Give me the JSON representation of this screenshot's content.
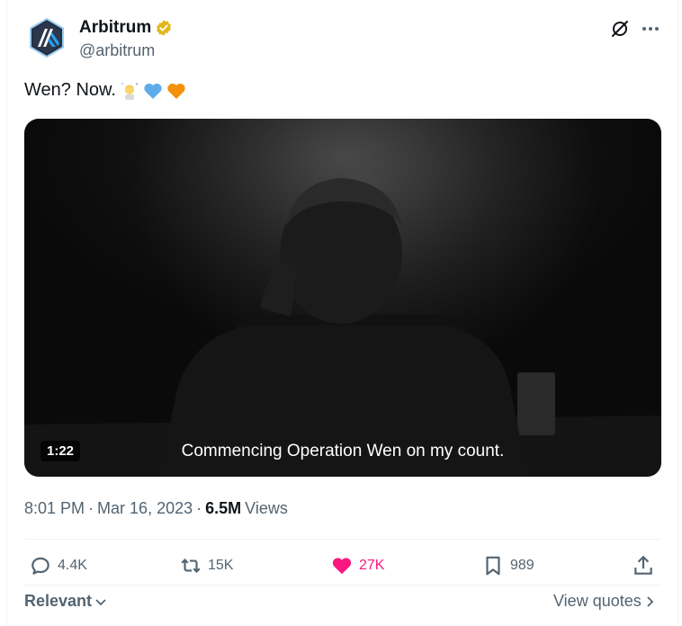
{
  "author": {
    "display_name": "Arbitrum",
    "handle": "@arbitrum",
    "verified_color": "#e2b719"
  },
  "tweet": {
    "text": "Wen? Now.",
    "emojis": [
      "mage-emoji",
      "blue-heart-emoji",
      "orange-heart-emoji"
    ]
  },
  "media": {
    "duration": "1:22",
    "caption": "Commencing Operation Wen on my count."
  },
  "meta": {
    "time": "8:01 PM",
    "separator1": "·",
    "date": "Mar 16, 2023",
    "separator2": "·",
    "views_count": "6.5M",
    "views_label": "Views"
  },
  "actions": {
    "replies": "4.4K",
    "reposts": "15K",
    "likes": "27K",
    "bookmarks": "989"
  },
  "footer": {
    "sort_label": "Relevant",
    "view_quotes": "View quotes"
  },
  "colors": {
    "like": "#f91880",
    "muted": "#536471",
    "text": "#0f1419"
  }
}
